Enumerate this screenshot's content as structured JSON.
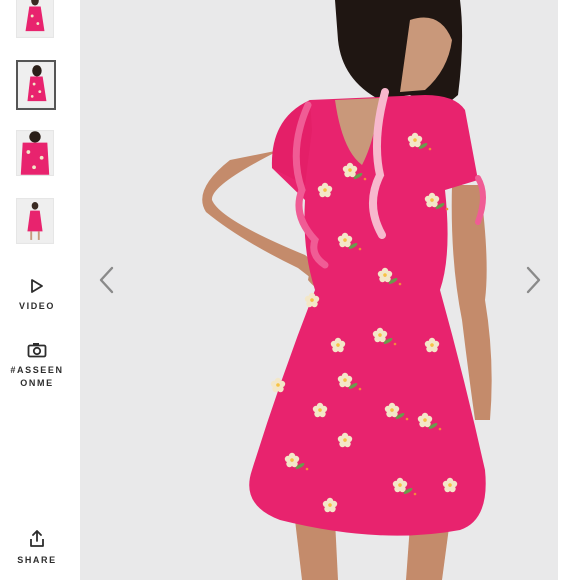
{
  "gallery": {
    "thumbnails": [
      {
        "label": "front view"
      },
      {
        "label": "back view",
        "selected": true
      },
      {
        "label": "close-up"
      },
      {
        "label": "full length"
      }
    ],
    "video_label": "VIDEO",
    "asseen_label_line1": "#ASSEEN",
    "asseen_label_line2": "ONME",
    "share_label": "SHARE"
  },
  "product_image": {
    "dress_color": "#e8236e",
    "flower_colors": [
      "#f3e7c8",
      "#f7c343",
      "#6a9b4b"
    ]
  },
  "icons": {
    "play": "play-icon",
    "camera": "camera-icon",
    "share": "share-icon",
    "prev": "chevron-left-icon",
    "next": "chevron-right-icon"
  }
}
